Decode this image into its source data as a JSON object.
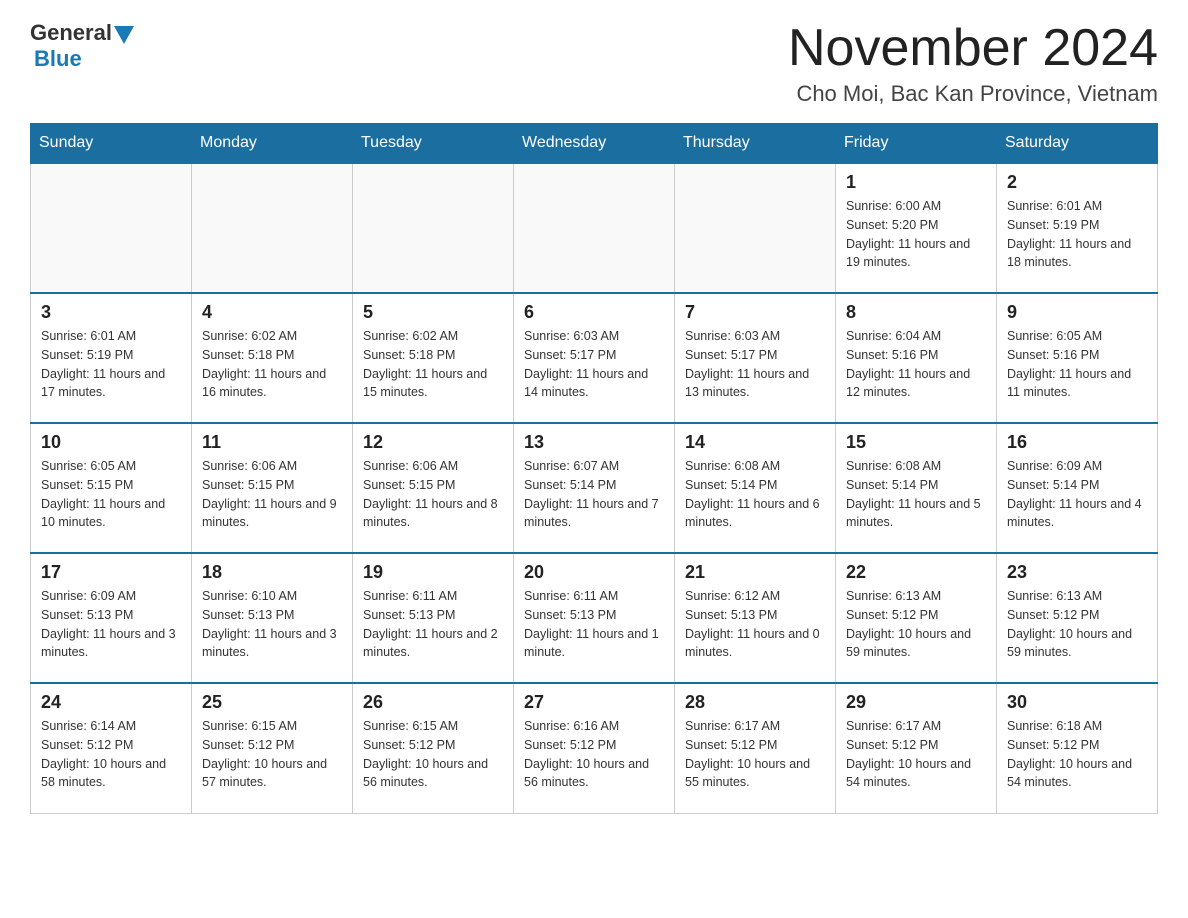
{
  "header": {
    "logo_general": "General",
    "logo_blue": "Blue",
    "month_title": "November 2024",
    "location": "Cho Moi, Bac Kan Province, Vietnam"
  },
  "days_of_week": [
    "Sunday",
    "Monday",
    "Tuesday",
    "Wednesday",
    "Thursday",
    "Friday",
    "Saturday"
  ],
  "weeks": [
    [
      {
        "day": "",
        "info": ""
      },
      {
        "day": "",
        "info": ""
      },
      {
        "day": "",
        "info": ""
      },
      {
        "day": "",
        "info": ""
      },
      {
        "day": "",
        "info": ""
      },
      {
        "day": "1",
        "info": "Sunrise: 6:00 AM\nSunset: 5:20 PM\nDaylight: 11 hours and 19 minutes."
      },
      {
        "day": "2",
        "info": "Sunrise: 6:01 AM\nSunset: 5:19 PM\nDaylight: 11 hours and 18 minutes."
      }
    ],
    [
      {
        "day": "3",
        "info": "Sunrise: 6:01 AM\nSunset: 5:19 PM\nDaylight: 11 hours and 17 minutes."
      },
      {
        "day": "4",
        "info": "Sunrise: 6:02 AM\nSunset: 5:18 PM\nDaylight: 11 hours and 16 minutes."
      },
      {
        "day": "5",
        "info": "Sunrise: 6:02 AM\nSunset: 5:18 PM\nDaylight: 11 hours and 15 minutes."
      },
      {
        "day": "6",
        "info": "Sunrise: 6:03 AM\nSunset: 5:17 PM\nDaylight: 11 hours and 14 minutes."
      },
      {
        "day": "7",
        "info": "Sunrise: 6:03 AM\nSunset: 5:17 PM\nDaylight: 11 hours and 13 minutes."
      },
      {
        "day": "8",
        "info": "Sunrise: 6:04 AM\nSunset: 5:16 PM\nDaylight: 11 hours and 12 minutes."
      },
      {
        "day": "9",
        "info": "Sunrise: 6:05 AM\nSunset: 5:16 PM\nDaylight: 11 hours and 11 minutes."
      }
    ],
    [
      {
        "day": "10",
        "info": "Sunrise: 6:05 AM\nSunset: 5:15 PM\nDaylight: 11 hours and 10 minutes."
      },
      {
        "day": "11",
        "info": "Sunrise: 6:06 AM\nSunset: 5:15 PM\nDaylight: 11 hours and 9 minutes."
      },
      {
        "day": "12",
        "info": "Sunrise: 6:06 AM\nSunset: 5:15 PM\nDaylight: 11 hours and 8 minutes."
      },
      {
        "day": "13",
        "info": "Sunrise: 6:07 AM\nSunset: 5:14 PM\nDaylight: 11 hours and 7 minutes."
      },
      {
        "day": "14",
        "info": "Sunrise: 6:08 AM\nSunset: 5:14 PM\nDaylight: 11 hours and 6 minutes."
      },
      {
        "day": "15",
        "info": "Sunrise: 6:08 AM\nSunset: 5:14 PM\nDaylight: 11 hours and 5 minutes."
      },
      {
        "day": "16",
        "info": "Sunrise: 6:09 AM\nSunset: 5:14 PM\nDaylight: 11 hours and 4 minutes."
      }
    ],
    [
      {
        "day": "17",
        "info": "Sunrise: 6:09 AM\nSunset: 5:13 PM\nDaylight: 11 hours and 3 minutes."
      },
      {
        "day": "18",
        "info": "Sunrise: 6:10 AM\nSunset: 5:13 PM\nDaylight: 11 hours and 3 minutes."
      },
      {
        "day": "19",
        "info": "Sunrise: 6:11 AM\nSunset: 5:13 PM\nDaylight: 11 hours and 2 minutes."
      },
      {
        "day": "20",
        "info": "Sunrise: 6:11 AM\nSunset: 5:13 PM\nDaylight: 11 hours and 1 minute."
      },
      {
        "day": "21",
        "info": "Sunrise: 6:12 AM\nSunset: 5:13 PM\nDaylight: 11 hours and 0 minutes."
      },
      {
        "day": "22",
        "info": "Sunrise: 6:13 AM\nSunset: 5:12 PM\nDaylight: 10 hours and 59 minutes."
      },
      {
        "day": "23",
        "info": "Sunrise: 6:13 AM\nSunset: 5:12 PM\nDaylight: 10 hours and 59 minutes."
      }
    ],
    [
      {
        "day": "24",
        "info": "Sunrise: 6:14 AM\nSunset: 5:12 PM\nDaylight: 10 hours and 58 minutes."
      },
      {
        "day": "25",
        "info": "Sunrise: 6:15 AM\nSunset: 5:12 PM\nDaylight: 10 hours and 57 minutes."
      },
      {
        "day": "26",
        "info": "Sunrise: 6:15 AM\nSunset: 5:12 PM\nDaylight: 10 hours and 56 minutes."
      },
      {
        "day": "27",
        "info": "Sunrise: 6:16 AM\nSunset: 5:12 PM\nDaylight: 10 hours and 56 minutes."
      },
      {
        "day": "28",
        "info": "Sunrise: 6:17 AM\nSunset: 5:12 PM\nDaylight: 10 hours and 55 minutes."
      },
      {
        "day": "29",
        "info": "Sunrise: 6:17 AM\nSunset: 5:12 PM\nDaylight: 10 hours and 54 minutes."
      },
      {
        "day": "30",
        "info": "Sunrise: 6:18 AM\nSunset: 5:12 PM\nDaylight: 10 hours and 54 minutes."
      }
    ]
  ]
}
